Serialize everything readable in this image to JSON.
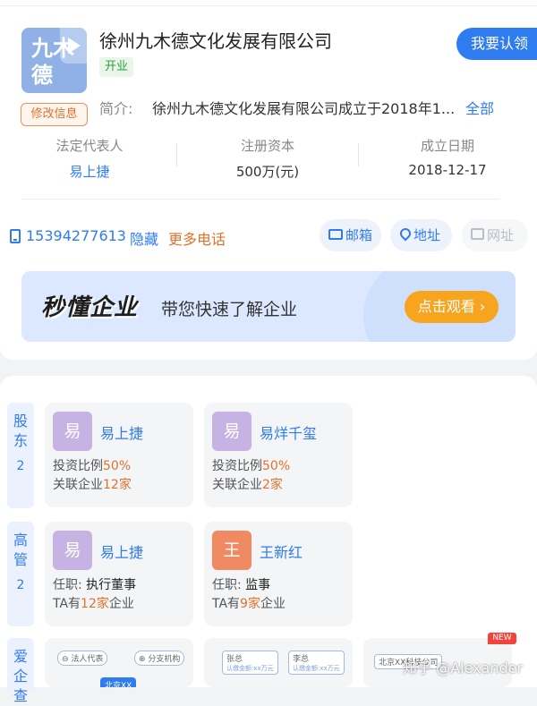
{
  "company": {
    "logo_text": "九木德",
    "name": "徐州九木德文化发展有限公司",
    "status": "开业",
    "edit_label": "修改信息",
    "claim_label": "我要认领",
    "intro_label": "简介:",
    "intro_text": "徐州九木德文化发展有限公司成立于2018年1...",
    "intro_all": "全部"
  },
  "info": [
    {
      "key": "法定代表人",
      "value": "易上捷"
    },
    {
      "key": "注册资本",
      "value": "500万(元)"
    },
    {
      "key": "成立日期",
      "value": "2018-12-17"
    }
  ],
  "contact": {
    "phone": "15394277613",
    "hide": "隐藏",
    "more_phones": "更多电话",
    "email": "邮箱",
    "address": "地址",
    "website": "网址"
  },
  "banner": {
    "brand": "秒懂企业",
    "slogan": "带您快速了解企业",
    "button": "点击观看 ›"
  },
  "shareholders": {
    "label": "股东",
    "count": "2",
    "items": [
      {
        "avatar": "易",
        "name": "易上捷",
        "line1_prefix": "投资比例",
        "line1_value": "50%",
        "line2_prefix": "关联企业",
        "line2_value": "12家"
      },
      {
        "avatar": "易",
        "name": "易烊千玺",
        "line1_prefix": "投资比例",
        "line1_value": "50%",
        "line2_prefix": "关联企业",
        "line2_value": "2家"
      }
    ]
  },
  "executives": {
    "label": "高管",
    "count": "2",
    "items": [
      {
        "avatar": "易",
        "name": "易上捷",
        "line1_prefix": "任职:",
        "line1_value": "执行董事",
        "line2_prefix": "TA有",
        "line2_value": "12家",
        "line2_suffix": "企业"
      },
      {
        "avatar": "王",
        "name": "王新红",
        "line1_prefix": "任职:",
        "line1_value": "监事",
        "line2_prefix": "TA有",
        "line2_value": "9家",
        "line2_suffix": "企业"
      }
    ]
  },
  "love": {
    "label": "爱企查",
    "thumb1": {
      "a": "法人代表",
      "b": "分支机构",
      "c": "北京XX"
    },
    "thumb2": {
      "a": "张总",
      "b": "李总",
      "c": "认缴金额:xx万元"
    },
    "thumb3": {
      "a": "北京XX科技公司"
    },
    "new_badge": "NEW"
  },
  "watermark": "知乎 @Alexander",
  "colors": {
    "accent": "#2f7bf0",
    "orange": "#e0722e",
    "green": "#2f9d3e",
    "avatar_purple": "#c7b3e3",
    "avatar_orange": "#f08a62"
  }
}
